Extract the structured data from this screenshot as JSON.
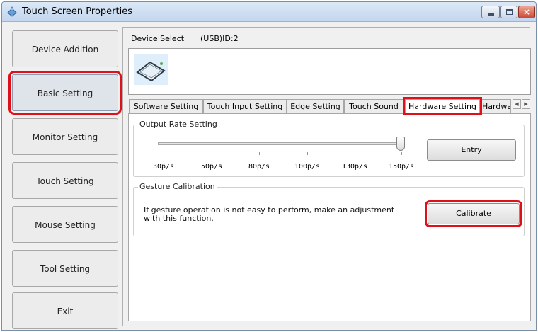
{
  "window": {
    "title": "Touch Screen Properties",
    "close_glyph": "×"
  },
  "sidebar": {
    "items": [
      {
        "label": "Device Addition",
        "selected": false
      },
      {
        "label": "Basic Setting",
        "selected": true
      },
      {
        "label": "Monitor Setting",
        "selected": false
      },
      {
        "label": "Touch Setting",
        "selected": false
      },
      {
        "label": "Mouse Setting",
        "selected": false
      },
      {
        "label": "Tool Setting",
        "selected": false
      },
      {
        "label": "Exit",
        "selected": false
      }
    ]
  },
  "device_select": {
    "label": "Device Select",
    "device_id": "(USB)ID:2",
    "device_icon": "touch-panel-icon"
  },
  "tabs": [
    {
      "label": "Software Setting",
      "active": false
    },
    {
      "label": "Touch Input Setting",
      "active": false
    },
    {
      "label": "Edge Setting",
      "active": false
    },
    {
      "label": "Touch Sound",
      "active": false
    },
    {
      "label": "Hardware Setting",
      "active": true
    },
    {
      "label": "Hardwa",
      "active": false
    }
  ],
  "tab_scroll": {
    "left_glyph": "◀",
    "right_glyph": "▶"
  },
  "output_rate": {
    "title": "Output Rate Setting",
    "ticks": [
      "30p/s",
      "50p/s",
      "80p/s",
      "100p/s",
      "130p/s",
      "150p/s"
    ],
    "selected_value": "150p/s",
    "entry_label": "Entry"
  },
  "gesture": {
    "title": "Gesture Calibration",
    "description": "If gesture operation is not easy to perform, make an adjustment with this function.",
    "calibrate_label": "Calibrate"
  },
  "colors": {
    "highlight": "#e0101a",
    "titlebar": "#c3d6ee",
    "close_button": "#cc4a31"
  }
}
